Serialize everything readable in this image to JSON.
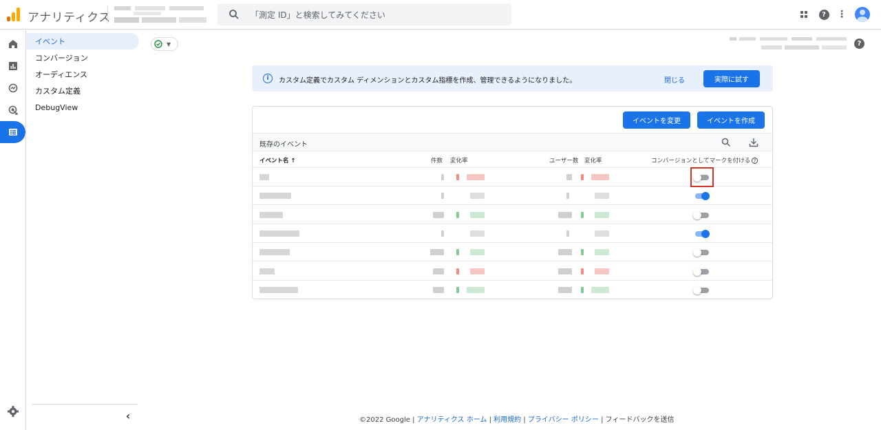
{
  "header": {
    "app_name": "アナリティクス",
    "search_placeholder": "「測定 ID」と検索してみてください",
    "help_glyph": "?",
    "more_glyph": "⋮"
  },
  "subnav": {
    "items": [
      {
        "label": "イベント",
        "active": true
      },
      {
        "label": "コンバージョン",
        "active": false
      },
      {
        "label": "オーディエンス",
        "active": false
      },
      {
        "label": "カスタム定義",
        "active": false
      },
      {
        "label": "DebugView",
        "active": false
      }
    ],
    "collapse_glyph": "‹"
  },
  "banner": {
    "message": "カスタム定義でカスタム ディメンションとカスタム指標を作成、管理できるようになりました。",
    "close_label": "閉じる",
    "try_label": "実際に試す",
    "info_glyph": "i"
  },
  "card": {
    "modify_event_label": "イベントを変更",
    "create_event_label": "イベントを作成",
    "existing_events_title": "既存のイベント",
    "columns": {
      "event_name": "イベント名",
      "sort_arrow": "↑",
      "count": "件数",
      "change_rate_1": "変化率",
      "users": "ユーザー数",
      "change_rate_2": "変化率",
      "mark_conversion": "コンバージョンとしてマークを付ける",
      "help_glyph": "?"
    },
    "rows": [
      {
        "conversion": false,
        "highlighted": true,
        "trend1": "down",
        "trend2": "down"
      },
      {
        "conversion": true,
        "highlighted": false,
        "trend1": "none",
        "trend2": "none"
      },
      {
        "conversion": false,
        "highlighted": false,
        "trend1": "up",
        "trend2": "up"
      },
      {
        "conversion": true,
        "highlighted": false,
        "trend1": "none",
        "trend2": "none"
      },
      {
        "conversion": false,
        "highlighted": false,
        "trend1": "up",
        "trend2": "up"
      },
      {
        "conversion": false,
        "highlighted": false,
        "trend1": "down",
        "trend2": "down"
      },
      {
        "conversion": false,
        "highlighted": false,
        "trend1": "up",
        "trend2": "up"
      }
    ]
  },
  "footer": {
    "copyright": "©2022 Google |",
    "home_link": "アナリティクス ホーム",
    "sep1": "|",
    "terms_link": "利用規約",
    "sep2": "|",
    "privacy_link": "プライバシー ポリシー",
    "sep3": "|",
    "feedback": "フィードバックを送信"
  },
  "colors": {
    "accent": "#1a73e8",
    "highlight_border": "#d93025",
    "trend_down": "#f28b82",
    "trend_up": "#81c995"
  }
}
